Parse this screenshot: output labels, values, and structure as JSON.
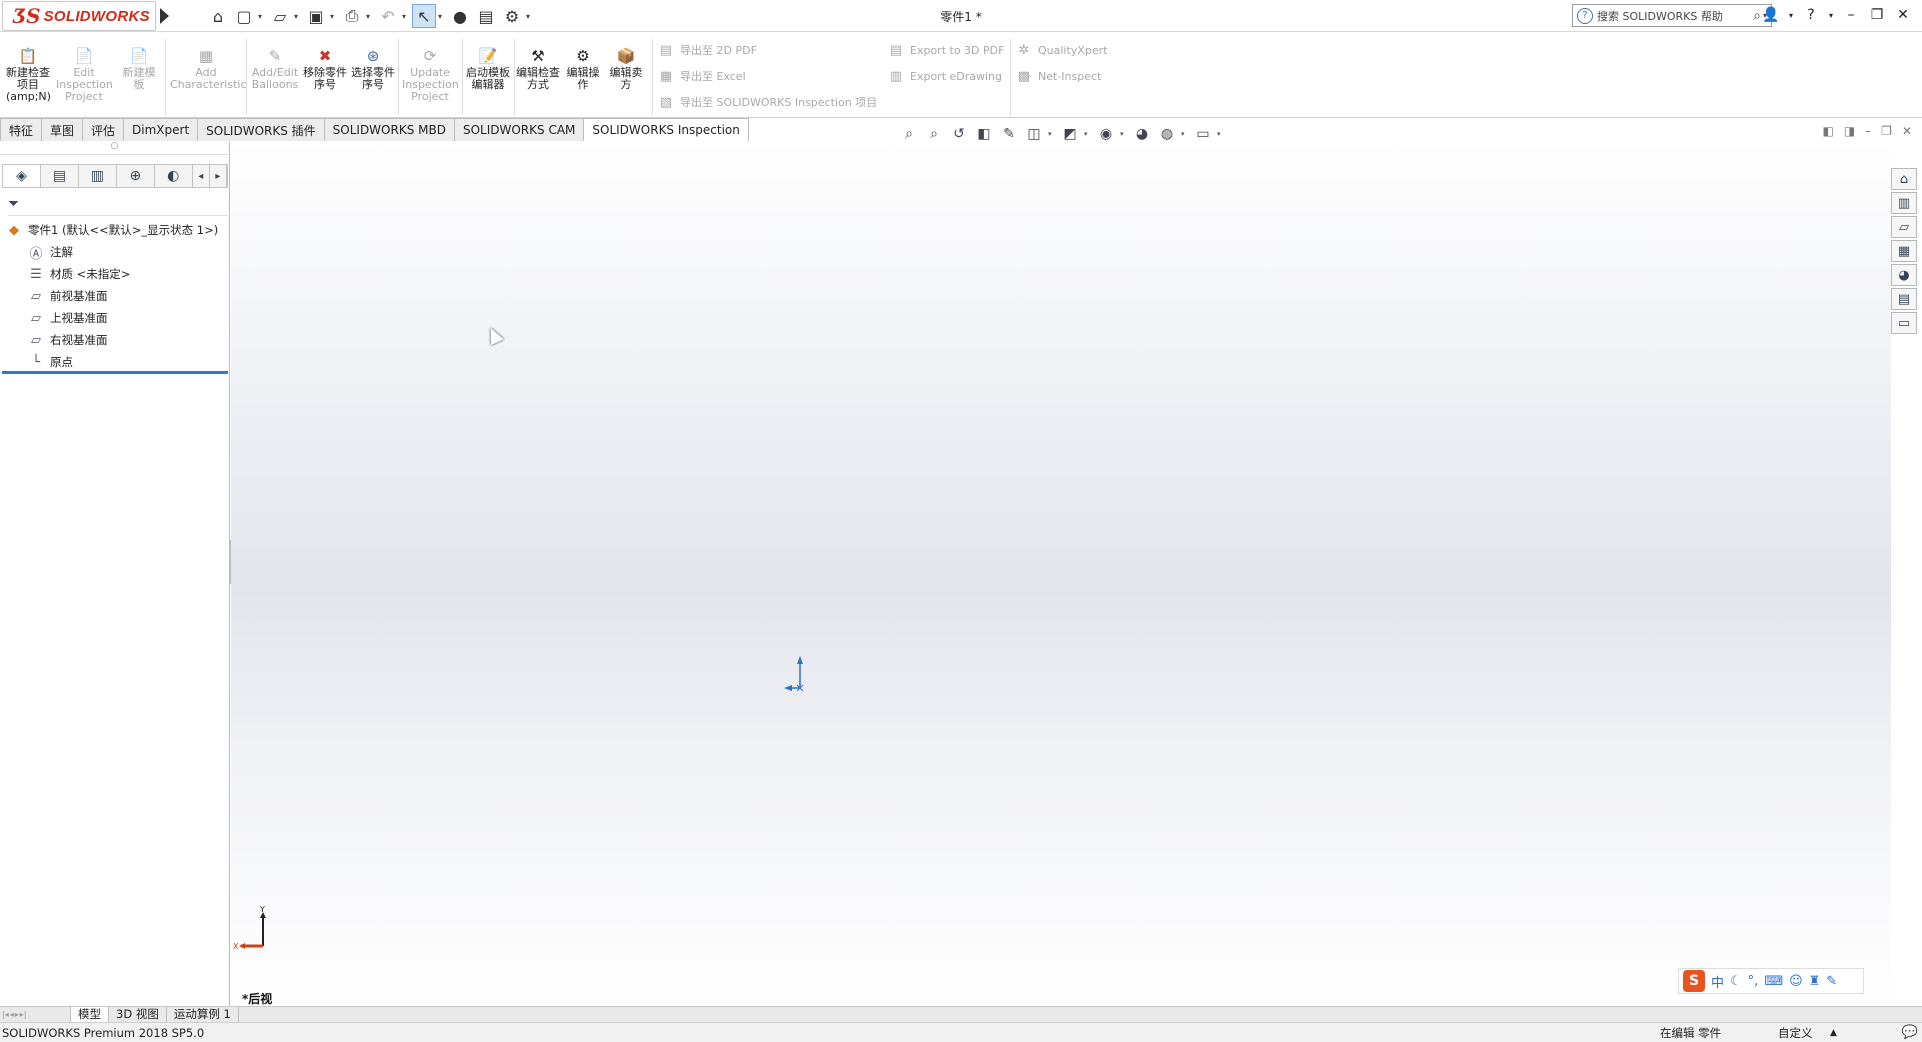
{
  "app": {
    "brand": "SOLIDWORKS",
    "window_title": "零件1 *",
    "search_placeholder": "搜索 SOLIDWORKS 帮助"
  },
  "quick_access": [
    {
      "name": "home-icon",
      "glyph": "⌂"
    },
    {
      "name": "new-document-icon",
      "glyph": "🗋"
    },
    {
      "name": "open-folder-icon",
      "glyph": "🗁"
    },
    {
      "name": "save-icon",
      "glyph": "💾"
    },
    {
      "name": "print-icon",
      "glyph": "🖶"
    },
    {
      "name": "undo-icon",
      "glyph": "↶"
    },
    {
      "name": "select-pointer-icon",
      "glyph": "↖"
    },
    {
      "name": "rebuild-icon",
      "glyph": "●"
    },
    {
      "name": "file-properties-icon",
      "glyph": "▤"
    },
    {
      "name": "options-gear-icon",
      "glyph": "⚙"
    }
  ],
  "ribbon": {
    "new_inspection_project": "新建检查项目(amp;N)",
    "edit_inspection_project": "Edit Inspection Project",
    "new_template": "新建模板",
    "add_characteristic": "Add Characteristic",
    "add_edit_balloons": "Add/Edit Balloons",
    "remove_part_number": "移除零件序号",
    "select_part_number": "选择零件序号",
    "update_inspection_project": "Update Inspection Project",
    "launch_template_editor": "启动模板编辑器",
    "edit_inspection_method": "编辑检查方式",
    "edit_operation": "编辑操作",
    "edit_vendor": "编辑卖方",
    "export_2d_pdf": "导出至 2D PDF",
    "export_excel": "导出至 Excel",
    "export_sw_inspection": "导出至 SOLIDWORKS Inspection 项目",
    "export_3d_pdf": "Export to 3D PDF",
    "export_edrawing": "Export eDrawing",
    "quality_xpert": "QualityXpert",
    "net_inspect": "Net-Inspect"
  },
  "tabs": [
    "特征",
    "草图",
    "评估",
    "DimXpert",
    "SOLIDWORKS 插件",
    "SOLIDWORKS MBD",
    "SOLIDWORKS CAM",
    "SOLIDWORKS Inspection"
  ],
  "active_tab_index": 7,
  "feature_tree": {
    "root": "零件1 (默认<<默认>_显示状态 1>)",
    "items": [
      "注解",
      "材质 <未指定>",
      "前视基准面",
      "上视基准面",
      "右视基准面",
      "原点"
    ]
  },
  "viewport": {
    "view_name": "*后视",
    "triad_y_label": "Y",
    "triad_x_label": "X"
  },
  "ime_bar": {
    "logo": "S",
    "mode": "中"
  },
  "bottom_tabs": [
    "模型",
    "3D 视图",
    "运动算例 1"
  ],
  "active_bottom_tab_index": 0,
  "status": {
    "product": "SOLIDWORKS Premium 2018 SP5.0",
    "editing": "在编辑 零件",
    "custom": "自定义",
    "caret": "▲"
  }
}
